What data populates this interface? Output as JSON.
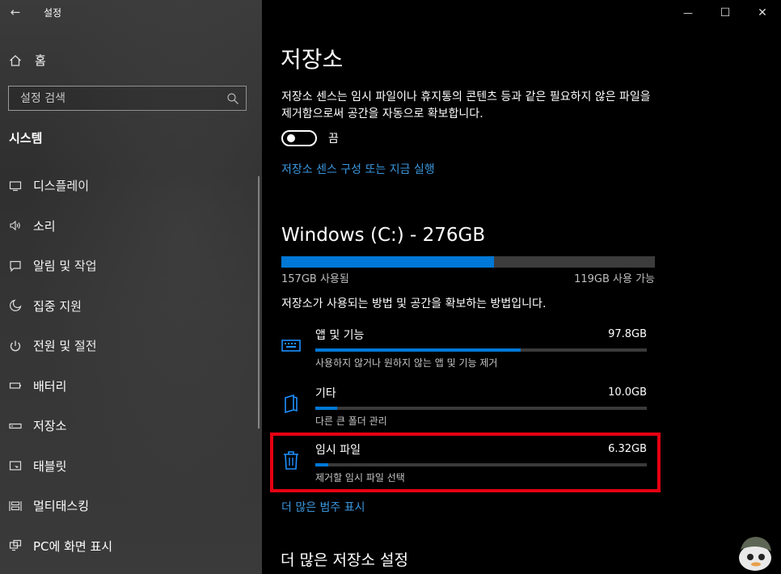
{
  "sidebar": {
    "back_glyph": "←",
    "title": "설정",
    "home_label": "홈",
    "search_placeholder": "설정 검색",
    "section_title": "시스템",
    "items": [
      {
        "label": "디스플레이",
        "icon": "monitor-icon"
      },
      {
        "label": "소리",
        "icon": "speaker-icon"
      },
      {
        "label": "알림 및 작업",
        "icon": "notification-icon"
      },
      {
        "label": "집중 지원",
        "icon": "moon-icon"
      },
      {
        "label": "전원 및 절전",
        "icon": "power-icon"
      },
      {
        "label": "배터리",
        "icon": "battery-icon"
      },
      {
        "label": "저장소",
        "icon": "storage-icon"
      },
      {
        "label": "태블릿",
        "icon": "tablet-icon"
      },
      {
        "label": "멀티태스킹",
        "icon": "multitasking-icon"
      },
      {
        "label": "PC에 화면 표시",
        "icon": "project-icon"
      }
    ]
  },
  "window": {
    "minimize": "—",
    "maximize": "☐",
    "close": "✕"
  },
  "main": {
    "title": "저장소",
    "description": "저장소 센스는 임시 파일이나 휴지통의 콘텐츠 등과 같은 필요하지 않은 파일을 제거함으로써 공간을 자동으로 확보합니다.",
    "toggle_state": "끔",
    "configure_link": "저장소 센스 구성 또는 지금 실행",
    "drive": {
      "title": "Windows (C:) - 276GB",
      "used_label": "157GB 사용됨",
      "available_label": "119GB 사용 가능",
      "used_fraction": 0.569
    },
    "info_text": "저장소가 사용되는 방법 및 공간을 확보하는 방법입니다.",
    "categories": [
      {
        "name": "앱 및 기능",
        "size": "97.8GB",
        "subtitle": "사용하지 않거나 원하지 않는 앱 및 기능 제거",
        "fraction": 0.62,
        "icon": "apps-icon"
      },
      {
        "name": "기타",
        "size": "10.0GB",
        "subtitle": "다른 큰 폴더 관리",
        "fraction": 0.065,
        "icon": "other-files-icon"
      },
      {
        "name": "임시 파일",
        "size": "6.32GB",
        "subtitle": "제거할 임시 파일 선택",
        "fraction": 0.04,
        "icon": "trash-icon"
      }
    ],
    "more_categories_link": "더 많은 범주 표시",
    "more_settings_title": "더 많은 저장소 설정"
  },
  "colors": {
    "accent": "#0078d7",
    "link": "#3a96dd",
    "highlight": "#e60012"
  }
}
